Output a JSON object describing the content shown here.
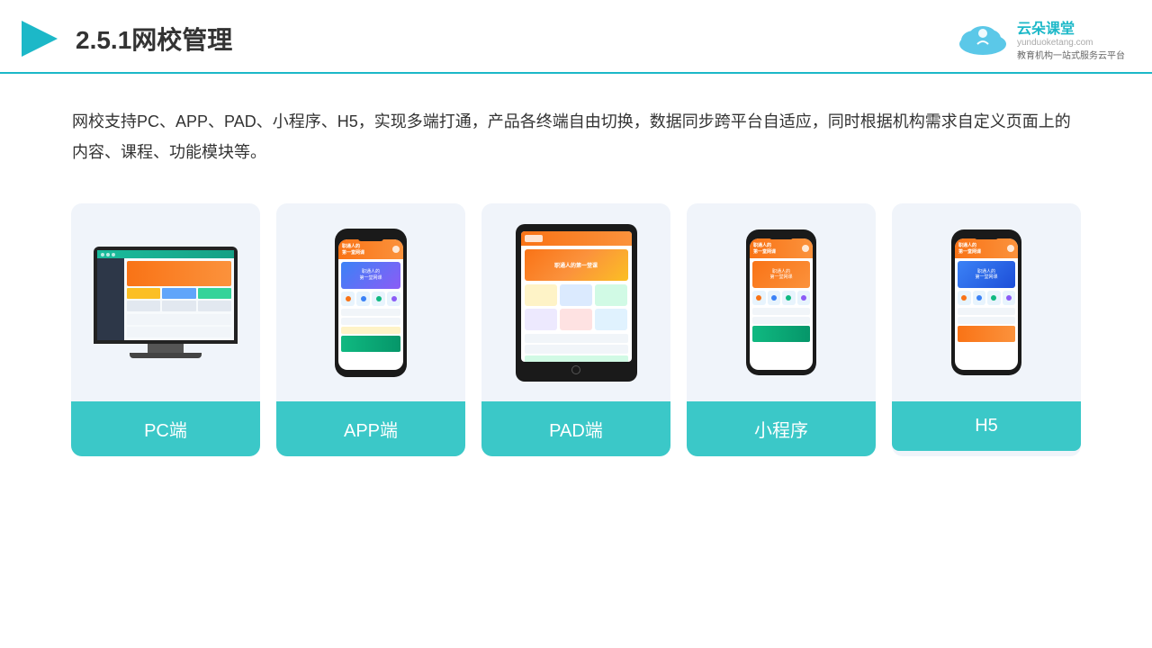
{
  "header": {
    "title": "2.5.1网校管理",
    "logo_name": "云朵课堂",
    "logo_domain": "yunduoketang.com",
    "logo_tagline": "教育机构一站式服务云平台"
  },
  "description": {
    "text": "网校支持PC、APP、PAD、小程序、H5，实现多端打通，产品各终端自由切换，数据同步跨平台自适应，同时根据机构需求自定义页面上的内容、课程、功能模块等。"
  },
  "cards": [
    {
      "label": "PC端",
      "type": "pc"
    },
    {
      "label": "APP端",
      "type": "phone"
    },
    {
      "label": "PAD端",
      "type": "tablet"
    },
    {
      "label": "小程序",
      "type": "mini-phone"
    },
    {
      "label": "H5",
      "type": "h5-phone"
    }
  ]
}
